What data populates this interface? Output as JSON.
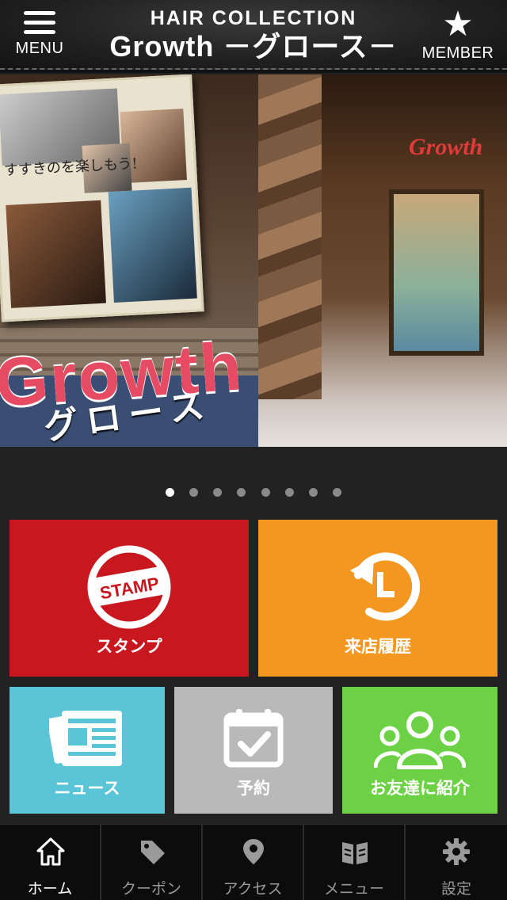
{
  "header": {
    "menu_label": "MENU",
    "member_label": "MEMBER",
    "brand_subtitle": "HAIR COLLECTION",
    "brand_title": "Growth －グロース－"
  },
  "hero": {
    "poster_text": "すすきのを楽しもう!",
    "sign_word": "Growth",
    "sign_kana": "グロース",
    "shop_sign": "Growth",
    "slide_count": 8,
    "active_slide": 1
  },
  "tiles": [
    {
      "label": "スタンプ",
      "icon": "stamp-icon",
      "badge_text": "STAMP",
      "color": "#c8171f"
    },
    {
      "label": "来店履歴",
      "icon": "history-icon",
      "color": "#f39720"
    },
    {
      "label": "ニュース",
      "icon": "newspaper-icon",
      "color": "#5ac5d6"
    },
    {
      "label": "予約",
      "icon": "calendar-check-icon",
      "color": "#b9b9b9"
    },
    {
      "label": "お友達に紹介",
      "icon": "people-icon",
      "color": "#6cd145"
    }
  ],
  "tabbar": {
    "items": [
      {
        "label": "ホーム",
        "icon": "home-icon",
        "active": true
      },
      {
        "label": "クーポン",
        "icon": "tag-icon",
        "active": false
      },
      {
        "label": "アクセス",
        "icon": "map-pin-icon",
        "active": false
      },
      {
        "label": "メニュー",
        "icon": "book-icon",
        "active": false
      },
      {
        "label": "設定",
        "icon": "gear-icon",
        "active": false
      }
    ]
  }
}
